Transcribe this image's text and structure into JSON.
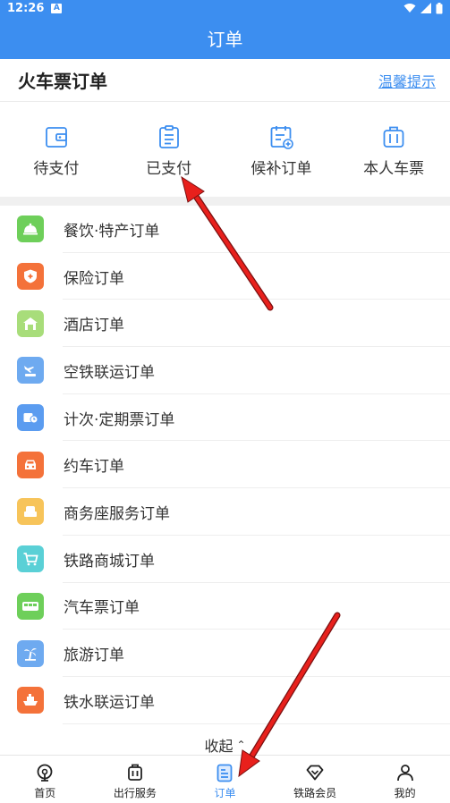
{
  "status": {
    "time": "12:26",
    "badge": "A"
  },
  "appbar": {
    "title": "订单"
  },
  "ticket": {
    "title": "火车票订单",
    "tip": "温馨提示",
    "quick": [
      {
        "label": "待支付",
        "icon": "wallet-icon"
      },
      {
        "label": "已支付",
        "icon": "clipboard-icon"
      },
      {
        "label": "候补订单",
        "icon": "calendar-add-icon"
      },
      {
        "label": "本人车票",
        "icon": "suitcase-icon"
      }
    ]
  },
  "orders": [
    {
      "label": "餐饮·特产订单",
      "icon": "food-cloche-icon",
      "color": "#6ecf5a"
    },
    {
      "label": "保险订单",
      "icon": "shield-icon",
      "color": "#f4723a"
    },
    {
      "label": "酒店订单",
      "icon": "hotel-icon",
      "color": "#a8dd7a"
    },
    {
      "label": "空铁联运订单",
      "icon": "plane-train-icon",
      "color": "#6eaaf0"
    },
    {
      "label": "计次·定期票订单",
      "icon": "ticket-clock-icon",
      "color": "#5b9cf0"
    },
    {
      "label": "约车订单",
      "icon": "car-icon",
      "color": "#f4723a"
    },
    {
      "label": "商务座服务订单",
      "icon": "seat-icon",
      "color": "#f7c45a"
    },
    {
      "label": "铁路商城订单",
      "icon": "cart-icon",
      "color": "#5ad0d6"
    },
    {
      "label": "汽车票订单",
      "icon": "bus-icon",
      "color": "#6ecf5a"
    },
    {
      "label": "旅游订单",
      "icon": "palm-tree-icon",
      "color": "#6eaaf0"
    },
    {
      "label": "铁水联运订单",
      "icon": "ship-icon",
      "color": "#f4723a"
    }
  ],
  "collapse_label": "收起",
  "tabs": [
    {
      "label": "首页",
      "icon": "home-icon"
    },
    {
      "label": "出行服务",
      "icon": "luggage-icon"
    },
    {
      "label": "订单",
      "icon": "order-doc-icon",
      "active": true
    },
    {
      "label": "铁路会员",
      "icon": "diamond-icon"
    },
    {
      "label": "我的",
      "icon": "person-icon"
    }
  ],
  "colors": {
    "primary": "#3c8ef0",
    "arrow": "#e8201c"
  }
}
